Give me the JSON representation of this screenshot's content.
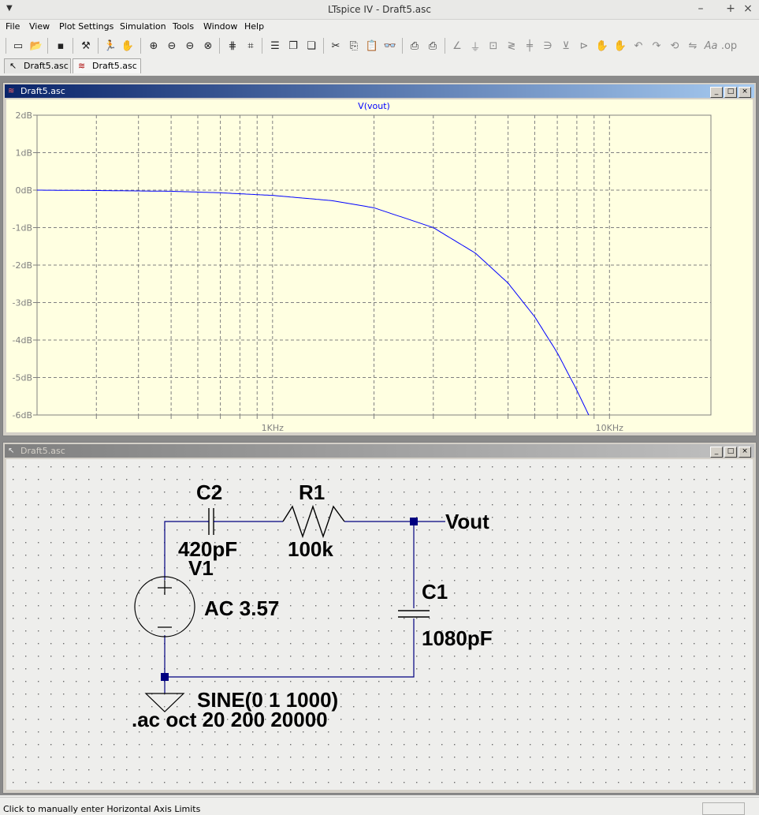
{
  "app": {
    "window_title": "LTspice IV - Draft5.asc",
    "window_controls": [
      "–",
      "+",
      "×"
    ]
  },
  "menu": [
    "File",
    "View",
    "Plot Settings",
    "Simulation",
    "Tools",
    "Window",
    "Help"
  ],
  "toolbar": {
    "icons": [
      "new-schematic-icon",
      "open-icon",
      "save-icon",
      "control-panel-icon",
      "run-icon",
      "pan-hand-icon",
      "zoom-in-icon",
      "zoom-out-icon",
      "zoom-area-icon",
      "zoom-cancel-icon",
      "autorange-icon",
      "marker-icon",
      "tile-horizontal-icon",
      "cascade-icon",
      "tile-vertical-icon",
      "cut-icon",
      "copy-icon",
      "paste-icon",
      "find-icon",
      "print-setup-icon",
      "print-icon",
      "wire-icon",
      "ground-icon",
      "label-net-icon",
      "resistor-icon",
      "capacitor-icon",
      "inductor-icon",
      "diode-icon",
      "component-icon",
      "move-icon",
      "drag-icon",
      "undo-icon",
      "redo-icon",
      "rotate-icon",
      "mirror-icon",
      "text-icon",
      "spice-directive-icon"
    ]
  },
  "tabs": [
    {
      "label": "Draft5.asc",
      "icon": "schematic-icon",
      "active": false
    },
    {
      "label": "Draft5.asc",
      "icon": "waveform-icon",
      "active": true
    }
  ],
  "waveform_window": {
    "title": "Draft5.asc",
    "trace_name": "V(vout)",
    "trace_color": "#0000ff",
    "background": "#ffffe1",
    "grid_color": "#808080",
    "controls": [
      "_",
      "□",
      "×"
    ]
  },
  "chart_data": {
    "type": "line",
    "title": "V(vout)",
    "xscale": "log",
    "xlim": [
      200,
      20000
    ],
    "ylim": [
      -6,
      2
    ],
    "yticks": [
      "2dB",
      "1dB",
      "0dB",
      "-1dB",
      "-2dB",
      "-3dB",
      "-4dB",
      "-5dB",
      "-6dB"
    ],
    "ytick_values": [
      2,
      1,
      0,
      -1,
      -2,
      -3,
      -4,
      -5,
      -6
    ],
    "xticks": [
      "1KHz",
      "10KHz"
    ],
    "xtick_values": [
      1000,
      10000
    ],
    "grid": true,
    "series": [
      {
        "name": "V(vout)",
        "x": [
          200,
          300,
          500,
          700,
          1000,
          1500,
          2000,
          3000,
          4000,
          5000,
          6000,
          7000,
          8000,
          9000,
          9400
        ],
        "y": [
          0.0,
          -0.01,
          -0.03,
          -0.07,
          -0.14,
          -0.28,
          -0.47,
          -1.0,
          -1.68,
          -2.48,
          -3.38,
          -4.34,
          -5.34,
          -6.3,
          -6.7
        ]
      }
    ]
  },
  "schematic_window": {
    "title": "Draft5.asc",
    "controls": [
      "_",
      "□",
      "×"
    ],
    "background": "#eeeeec",
    "wire_color": "#000080",
    "components": {
      "c2_name": "C2",
      "c2_value": "420pF",
      "r1_name": "R1",
      "r1_value": "100k",
      "c1_name": "C1",
      "c1_value": "1080pF",
      "v1_name": "V1",
      "v1_ac": "AC 3.57",
      "v1_sine": "SINE(0 1 1000)",
      "net_label": "Vout",
      "directive": ".ac oct 20 200 20000"
    }
  },
  "status": {
    "message": "Click to manually enter Horizontal Axis Limits"
  }
}
